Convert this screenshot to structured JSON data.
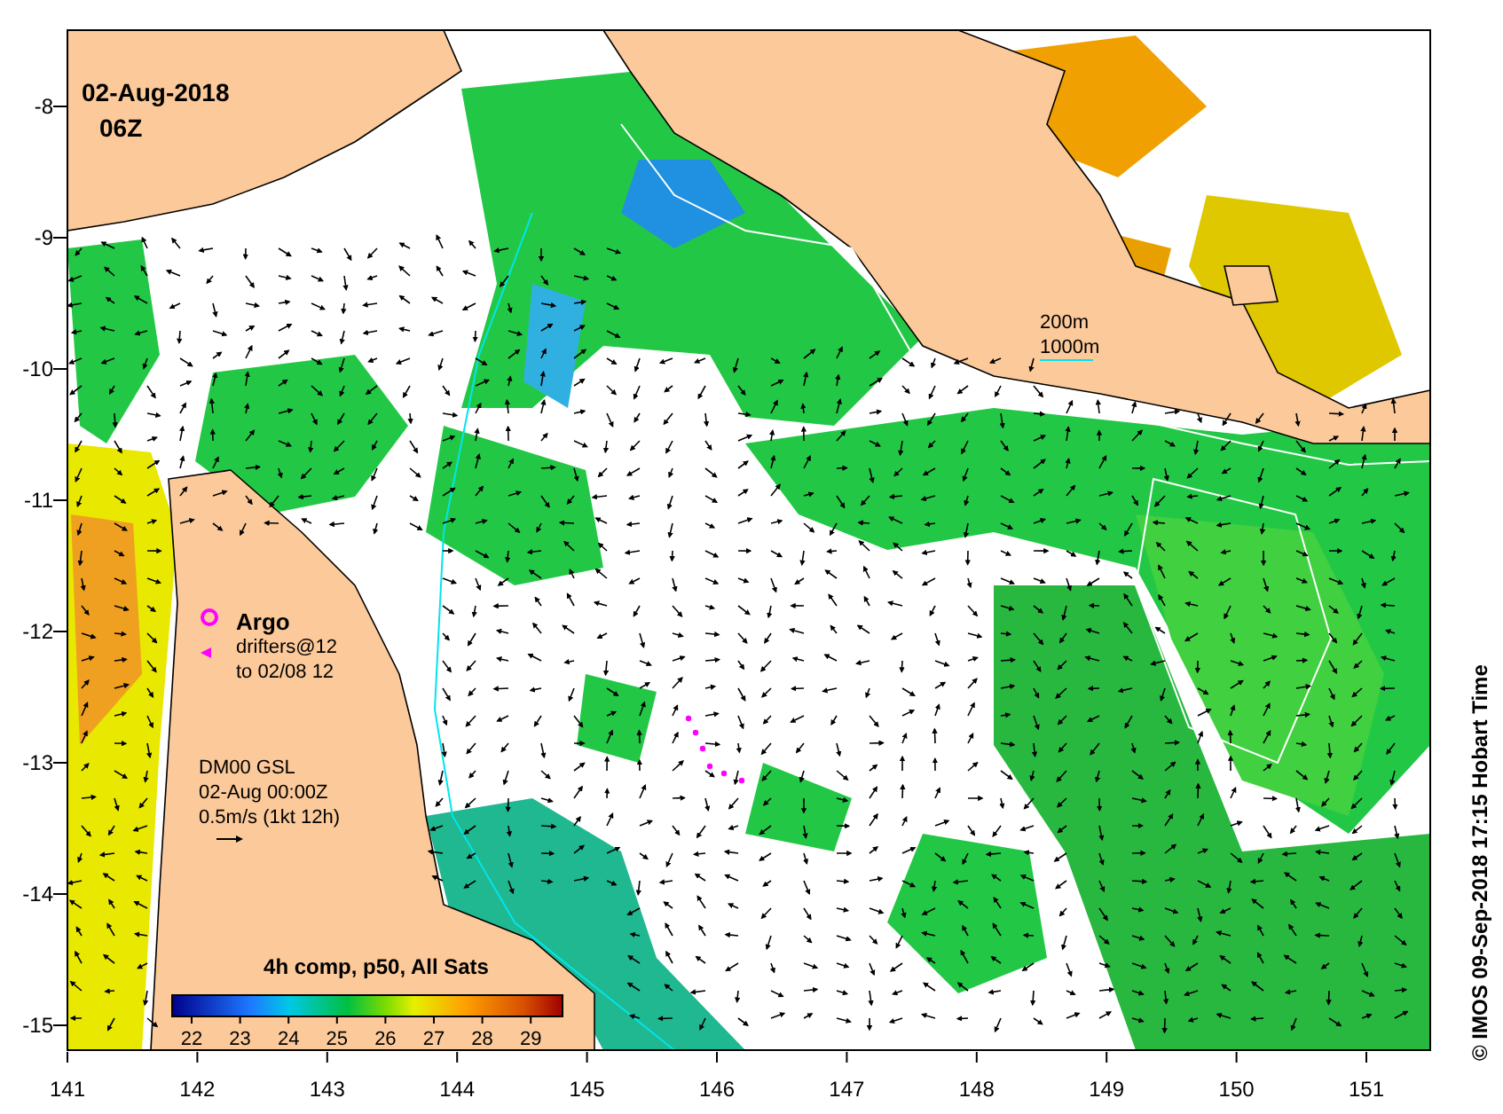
{
  "map": {
    "date": "02-Aug-2018",
    "time": "06Z",
    "depth_legend": [
      "200m",
      "1000m"
    ],
    "argo_legend": {
      "title": "Argo",
      "line_1": "drifters@12",
      "line_2": "to 02/08 12"
    },
    "current_legend": [
      "DM00 GSL",
      "02-Aug 00:00Z",
      "0.5m/s (1kt 12h)"
    ],
    "colorbar": {
      "title": "4h comp, p50, All Sats",
      "ticks": [
        "22",
        "23",
        "24",
        "25",
        "26",
        "27",
        "28",
        "29"
      ]
    },
    "x_ticks": [
      "141",
      "142",
      "143",
      "144",
      "145",
      "146",
      "147",
      "148",
      "149",
      "150",
      "151"
    ],
    "y_ticks": [
      "-8",
      "-9",
      "-10",
      "-11",
      "-12",
      "-13",
      "-14",
      "-15"
    ]
  },
  "credit": "© IMOS 09-Sep-2018 17:15 Hobart Time"
}
